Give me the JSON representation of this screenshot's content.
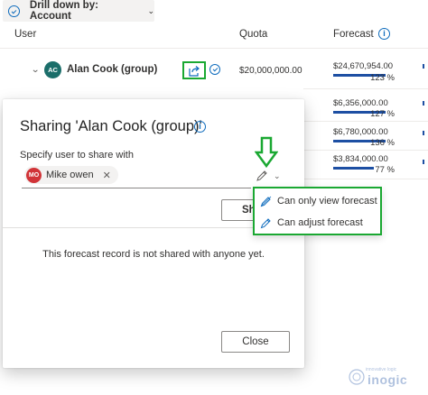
{
  "toolbar": {
    "drill_label": "Drill down by: Account"
  },
  "columns": {
    "user": "User",
    "quota": "Quota",
    "forecast": "Forecast"
  },
  "main_row": {
    "avatar_initials": "AC",
    "name": "Alan Cook (group)",
    "quota": "$20,000,000.00",
    "forecast": "$24,670,954.00",
    "percent": "123 %"
  },
  "sub_rows": [
    {
      "forecast": "$6,356,000.00",
      "percent": "127 %",
      "progress_pct": 100
    },
    {
      "forecast": "$6,780,000.00",
      "percent": "136 %",
      "progress_pct": 100
    },
    {
      "forecast": "$3,834,000.00",
      "percent": "77 %",
      "progress_pct": 77
    }
  ],
  "dialog": {
    "title": "Sharing 'Alan Cook (group)'",
    "specify_label": "Specify user to share with",
    "selected_user": {
      "initials": "MO",
      "name": "Mike owen"
    },
    "share_button": "Sh",
    "empty_message": "This forecast record is not shared with anyone yet.",
    "close_button": "Close"
  },
  "permission_menu": {
    "items": [
      {
        "label": "Can only view forecast",
        "icon": "pencil-view-icon"
      },
      {
        "label": "Can adjust forecast",
        "icon": "pencil-edit-icon"
      }
    ]
  },
  "watermark": {
    "tagline": "innovative logic",
    "brand": "inogic"
  },
  "colors": {
    "accent": "#0f6cbd",
    "annotation": "#1aa832",
    "bar": "#1d4fa3",
    "avatar_user": "#d13438",
    "avatar_group": "#1b6e6a"
  }
}
